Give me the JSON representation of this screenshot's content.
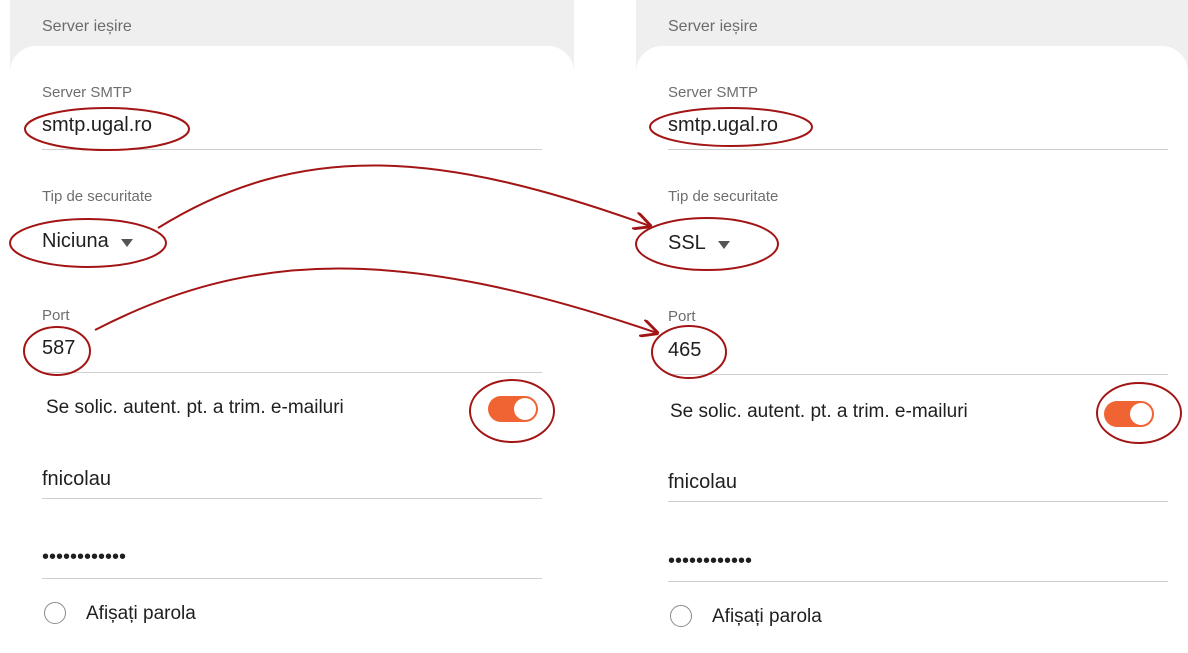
{
  "annotation_color": "#a31515",
  "accent_color": "#f06433",
  "left": {
    "section_title": "Server ieșire",
    "smtp_label": "Server SMTP",
    "smtp_value": "smtp.ugal.ro",
    "security_label": "Tip de securitate",
    "security_value": "Niciuna",
    "port_label": "Port",
    "port_value": "587",
    "auth_label": "Se solic. autent. pt. a trim. e-mailuri",
    "auth_enabled": true,
    "username": "fnicolau",
    "password": "••••••••••••",
    "show_password_label": "Afișați parola"
  },
  "right": {
    "section_title": "Server ieșire",
    "smtp_label": "Server SMTP",
    "smtp_value": "smtp.ugal.ro",
    "security_label": "Tip de securitate",
    "security_value": "SSL",
    "port_label": "Port",
    "port_value": "465",
    "auth_label": "Se solic. autent. pt. a trim. e-mailuri",
    "auth_enabled": true,
    "username": "fnicolau",
    "password": "••••••••••••",
    "show_password_label": "Afișați parola"
  },
  "icons": {
    "dropdown": "chevron-down-icon",
    "toggle": "toggle-on-icon",
    "radio": "radio-unchecked-icon",
    "arrow": "arrow-right-icon"
  }
}
